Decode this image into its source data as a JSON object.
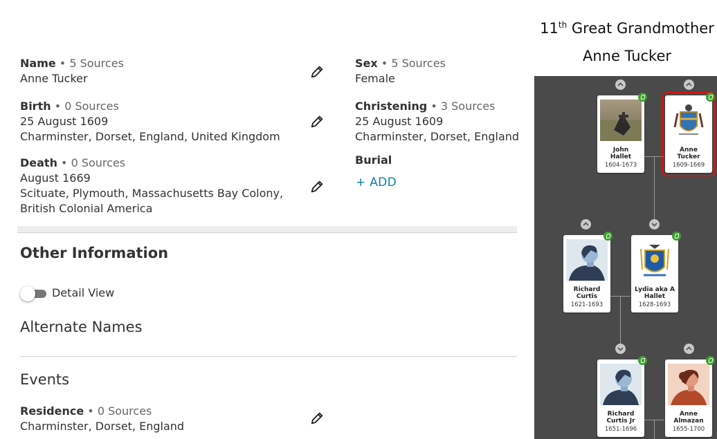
{
  "facts": {
    "name": {
      "label": "Name",
      "sources": "5 Sources",
      "value": "Anne Tucker"
    },
    "sex": {
      "label": "Sex",
      "sources": "5 Sources",
      "value": "Female"
    },
    "birth": {
      "label": "Birth",
      "sources": "0 Sources",
      "date": "25 August 1609",
      "place": "Charminster, Dorset, England, United Kingdom"
    },
    "christening": {
      "label": "Christening",
      "sources": "3 Sources",
      "date": "25 August 1609",
      "place": "Charminster, Dorset, England"
    },
    "death": {
      "label": "Death",
      "sources": "0 Sources",
      "date": "August 1669",
      "place_line1": "Scituate, Plymouth, Massachusetts Bay Colony,",
      "place_line2": "British Colonial America"
    },
    "burial": {
      "label": "Burial",
      "add_label": "+  ADD"
    }
  },
  "other_info": {
    "title": "Other Information",
    "detail_view_label": "Detail View",
    "alternate_names_title": "Alternate Names",
    "events_title": "Events",
    "residence": {
      "label": "Residence",
      "sources": "0 Sources",
      "place": "Charminster, Dorset, England"
    }
  },
  "relationship": {
    "ordinal": "11",
    "ordinal_suffix": "th",
    "relation": "Great Grandmother",
    "person": "Anne Tucker"
  },
  "tree": {
    "cards": [
      {
        "name1": "John",
        "name2": "Hallet",
        "years": "1604-1673"
      },
      {
        "name1": "Anne",
        "name2": "Tucker",
        "years": "1609-1669"
      },
      {
        "name1": "Richard",
        "name2": "Curtis",
        "years": "1621-1693"
      },
      {
        "name1": "Lydia aka A",
        "name2": "Hallet",
        "years": "1628-1693"
      },
      {
        "name1": "Richard",
        "name2": "Curtis Jr",
        "years": "1651-1696"
      },
      {
        "name1": "Anne",
        "name2": "Almazan",
        "years": "1655-1700"
      }
    ]
  },
  "colors": {
    "accent": "#0a7ea8",
    "tree_bg": "#4a4a4a",
    "leaf": "#3aa12b",
    "selected": "#dd1111"
  }
}
